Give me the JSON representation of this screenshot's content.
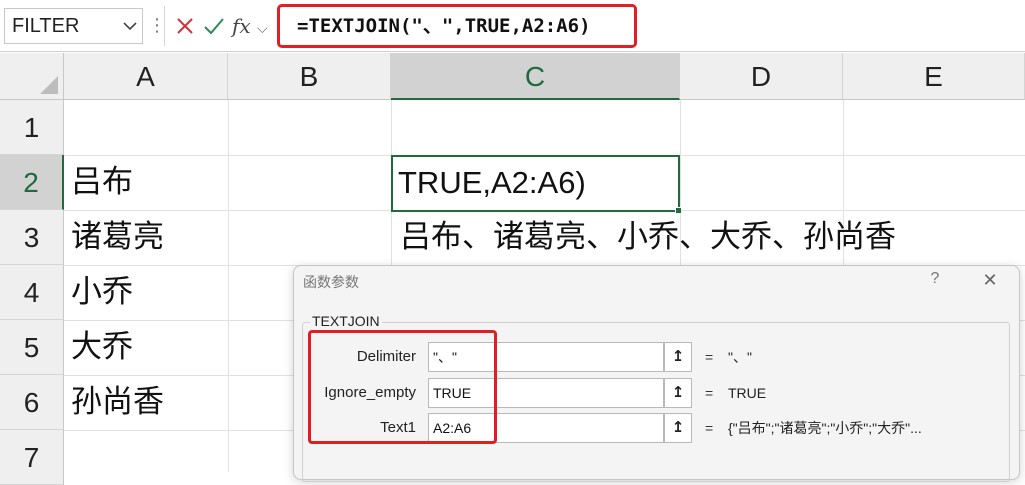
{
  "formula_bar": {
    "name_box": "FILTER",
    "more": "⋮",
    "cancel_glyph": "✕",
    "enter_glyph": "✓",
    "fx_label": "fx",
    "fx_chevron": "⌵",
    "formula": "=TEXTJOIN(\"、\",TRUE,A2:A6)"
  },
  "columns": [
    "A",
    "B",
    "C",
    "D",
    "E"
  ],
  "rows": [
    "1",
    "2",
    "3",
    "4",
    "5",
    "6",
    "7"
  ],
  "cells": {
    "A2": "吕布",
    "A3": "诸葛亮",
    "A4": "小乔",
    "A5": "大乔",
    "A6": "孙尚香",
    "C2": "TRUE,A2:A6)",
    "C3": "吕布、诸葛亮、小乔、大乔、孙尚香"
  },
  "dialog": {
    "title": "函数参数",
    "help": "?",
    "close": "✕",
    "function_name": "TEXTJOIN",
    "collapse_glyph": "↥",
    "args": [
      {
        "label": "Delimiter",
        "value": "\"、\"",
        "eq": "=",
        "result": "\"、\""
      },
      {
        "label": "Ignore_empty",
        "value": "TRUE",
        "eq": "=",
        "result": "TRUE"
      },
      {
        "label": "Text1",
        "value": "A2:A6",
        "eq": "=",
        "result": "{\"吕布\";\"诸葛亮\";\"小乔\";\"大乔\"..."
      }
    ]
  },
  "colors": {
    "highlight_red": "#e02020",
    "excel_green": "#1e6b3b",
    "cancel_red": "#d13438",
    "enter_green": "#2e8b57"
  }
}
